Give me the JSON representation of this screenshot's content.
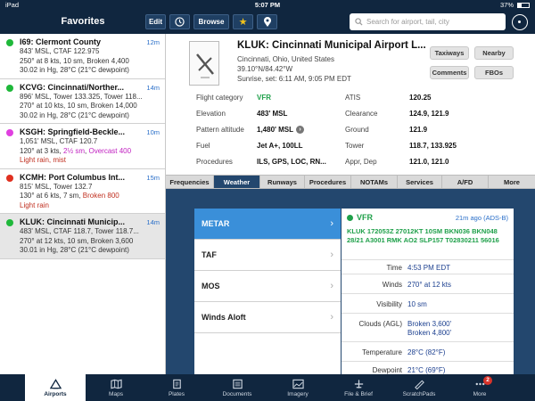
{
  "status_bar": {
    "carrier": "iPad",
    "time": "5:07 PM",
    "battery": "37%"
  },
  "nav": {
    "title": "Favorites",
    "edit_label": "Edit",
    "browse_label": "Browse",
    "search_placeholder": "Search for airport, tail, city"
  },
  "favorites": [
    {
      "name": "I69: Clermont County",
      "age": "12m",
      "color": "#1fb83a",
      "line1": "843' MSL, CTAF 122.975",
      "line2": "250° at 8 kts, 10 sm, Broken 4,400",
      "line3": "30.02 in Hg, 28°C (21°C dewpoint)"
    },
    {
      "name": "KCVG: Cincinnati/Norther...",
      "age": "14m",
      "color": "#1fb83a",
      "line1": "896' MSL, Tower 133.325, Tower 118...",
      "line2": "270° at 10 kts, 10 sm, Broken 14,000",
      "line3": "30.02 in Hg, 28°C (21°C dewpoint)"
    },
    {
      "name": "KSGH: Springfield-Beckle...",
      "age": "10m",
      "color": "#e040e0",
      "line1": "1,051' MSL, CTAF 120.7",
      "line2_a": "120° at 3 kts, ",
      "line2_b": "2½ sm",
      "line2_c": ", ",
      "line2_d": "Overcast 400",
      "line3": "Light rain, mist"
    },
    {
      "name": "KCMH: Port Columbus Int...",
      "age": "15m",
      "color": "#e03020",
      "line1": "815' MSL, Tower 132.7",
      "line2_a": "130° at 6 kts, 7 sm, ",
      "line2_b": "Broken 800",
      "line3": "Light rain"
    },
    {
      "name": "KLUK: Cincinnati Municip...",
      "age": "14m",
      "color": "#1fb83a",
      "line1": "483' MSL, CTAF 118.7, Tower 118.7...",
      "line2": "270° at 12 kts, 10 sm, Broken 3,600",
      "line3": "30.01 in Hg, 28°C (21°C dewpoint)"
    }
  ],
  "airport": {
    "name": "KLUK: Cincinnati Municipal Airport L...",
    "location": "Cincinnati, Ohio, United States",
    "coords": "39.10°N/84.42°W",
    "sun": "Sunrise, set: 6:11 AM, 9:05 PM EDT",
    "buttons": {
      "taxiways": "Taxiways",
      "nearby": "Nearby",
      "comments": "Comments",
      "fbos": "FBOs"
    }
  },
  "info": {
    "left": [
      {
        "label": "Flight category",
        "value": "VFR"
      },
      {
        "label": "Elevation",
        "value": "483' MSL"
      },
      {
        "label": "Pattern altitude",
        "value": "1,480' MSL"
      },
      {
        "label": "Fuel",
        "value": "Jet A+, 100LL"
      },
      {
        "label": "Procedures",
        "value": "ILS, GPS, LOC, RN..."
      }
    ],
    "right": [
      {
        "label": "ATIS",
        "value": "120.25"
      },
      {
        "label": "Clearance",
        "value": "124.9, 121.9"
      },
      {
        "label": "Ground",
        "value": "121.9"
      },
      {
        "label": "Tower",
        "value": "118.7, 133.925"
      },
      {
        "label": "Appr, Dep",
        "value": "121.0, 121.0"
      }
    ]
  },
  "tabs": [
    "Frequencies",
    "Weather",
    "Runways",
    "Procedures",
    "NOTAMs",
    "Services",
    "A/FD",
    "More"
  ],
  "weather_menu": [
    "METAR",
    "TAF",
    "MOS",
    "Winds Aloft"
  ],
  "metar": {
    "category": "VFR",
    "age": "21m ago (ADS-B)",
    "raw": "KLUK 172053Z 27012KT 10SM BKN036 BKN048 28/21 A3001 RMK AO2 SLP157 T02830211 56016",
    "rows": [
      {
        "label": "Time",
        "value": "4:53 PM EDT"
      },
      {
        "label": "Winds",
        "value": "270° at 12 kts"
      },
      {
        "label": "Visibility",
        "value": "10 sm"
      },
      {
        "label": "Clouds (AGL)",
        "value": "Broken 3,600'",
        "value2": "Broken 4,800'"
      },
      {
        "label": "Temperature",
        "value": "28°C (82°F)"
      },
      {
        "label": "Dewpoint",
        "value": "21°C (69°F)"
      }
    ]
  },
  "tabbar": [
    {
      "label": "Airports",
      "icon": "airports-icon"
    },
    {
      "label": "Maps",
      "icon": "maps-icon"
    },
    {
      "label": "Plates",
      "icon": "plates-icon"
    },
    {
      "label": "Documents",
      "icon": "documents-icon"
    },
    {
      "label": "Imagery",
      "icon": "imagery-icon"
    },
    {
      "label": "File & Brief",
      "icon": "file-brief-icon"
    },
    {
      "label": "ScratchPads",
      "icon": "scratchpads-icon"
    },
    {
      "label": "More",
      "icon": "more-icon",
      "badge": "2"
    }
  ],
  "colors": {
    "navy": "#10263f",
    "selected_blue": "#3a8fd9",
    "vfr_green": "#1fa04a",
    "ifr_red": "#c03020"
  }
}
